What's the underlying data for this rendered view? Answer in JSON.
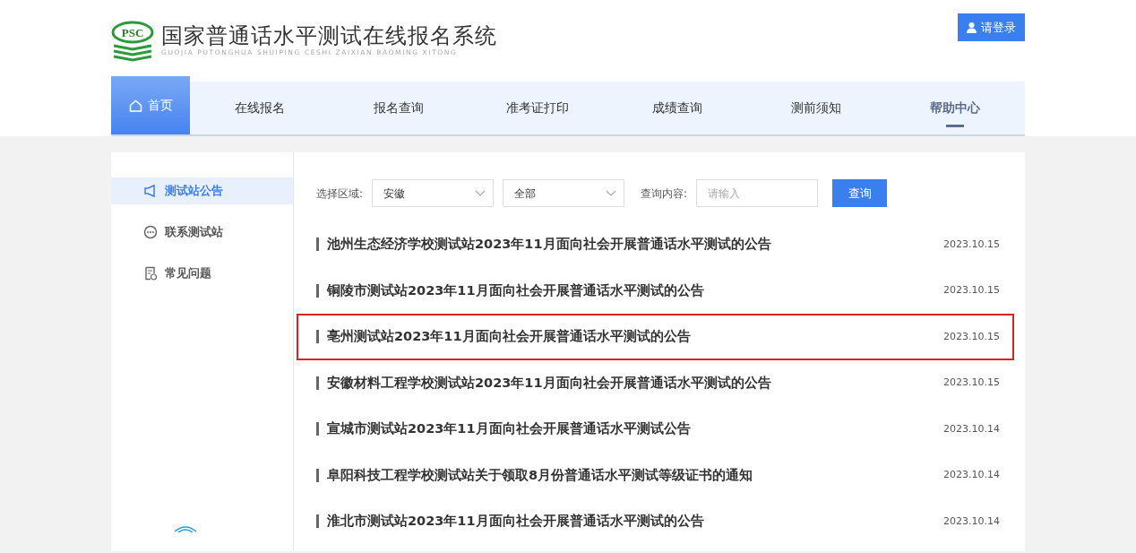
{
  "header": {
    "logo_text": "PSC",
    "title": "国家普通话水平测试在线报名系统",
    "subtitle": "GUOJIA PUTONGHUA SHUIPING CESHI ZAIXIAN BAOMING XITONG",
    "login_button": "请登录"
  },
  "nav": [
    {
      "label": "首页",
      "selected": true,
      "underlined": false
    },
    {
      "label": "在线报名",
      "selected": false,
      "underlined": false
    },
    {
      "label": "报名查询",
      "selected": false,
      "underlined": false
    },
    {
      "label": "准考证打印",
      "selected": false,
      "underlined": false
    },
    {
      "label": "成绩查询",
      "selected": false,
      "underlined": false
    },
    {
      "label": "测前须知",
      "selected": false,
      "underlined": false
    },
    {
      "label": "帮助中心",
      "selected": false,
      "underlined": true
    }
  ],
  "sidebar": {
    "items": [
      {
        "label": "测试站公告",
        "kind": "megaphone",
        "selected": true
      },
      {
        "label": "联系测试站",
        "kind": "chat",
        "selected": false
      },
      {
        "label": "常见问题",
        "kind": "document",
        "selected": false
      }
    ]
  },
  "filters": {
    "region_label": "选择区域:",
    "region_value": "安徽",
    "category_value": "全部",
    "query_label": "查询内容:",
    "query_placeholder": "请输入",
    "search_button": "查询"
  },
  "announcements": [
    {
      "title": "池州生态经济学校测试站2023年11月面向社会开展普通话水平测试的公告",
      "date": "2023.10.15",
      "selected": false
    },
    {
      "title": "铜陵市测试站2023年11月面向社会开展普通话水平测试的公告",
      "date": "2023.10.15",
      "selected": false
    },
    {
      "title": "亳州测试站2023年11月面向社会开展普通话水平测试的公告",
      "date": "2023.10.15",
      "selected": true
    },
    {
      "title": "安徽材料工程学校测试站2023年11月面向社会开展普通话水平测试的公告",
      "date": "2023.10.15",
      "selected": false
    },
    {
      "title": "宣城市测试站2023年11月面向社会开展普通话水平测试公告",
      "date": "2023.10.14",
      "selected": false
    },
    {
      "title": "阜阳科技工程学校测试站关于领取8月份普通话水平测试等级证书的通知",
      "date": "2023.10.14",
      "selected": false
    },
    {
      "title": "淮北市测试站2023年11月面向社会开展普通话水平测试的公告",
      "date": "2023.10.14",
      "selected": false
    }
  ]
}
